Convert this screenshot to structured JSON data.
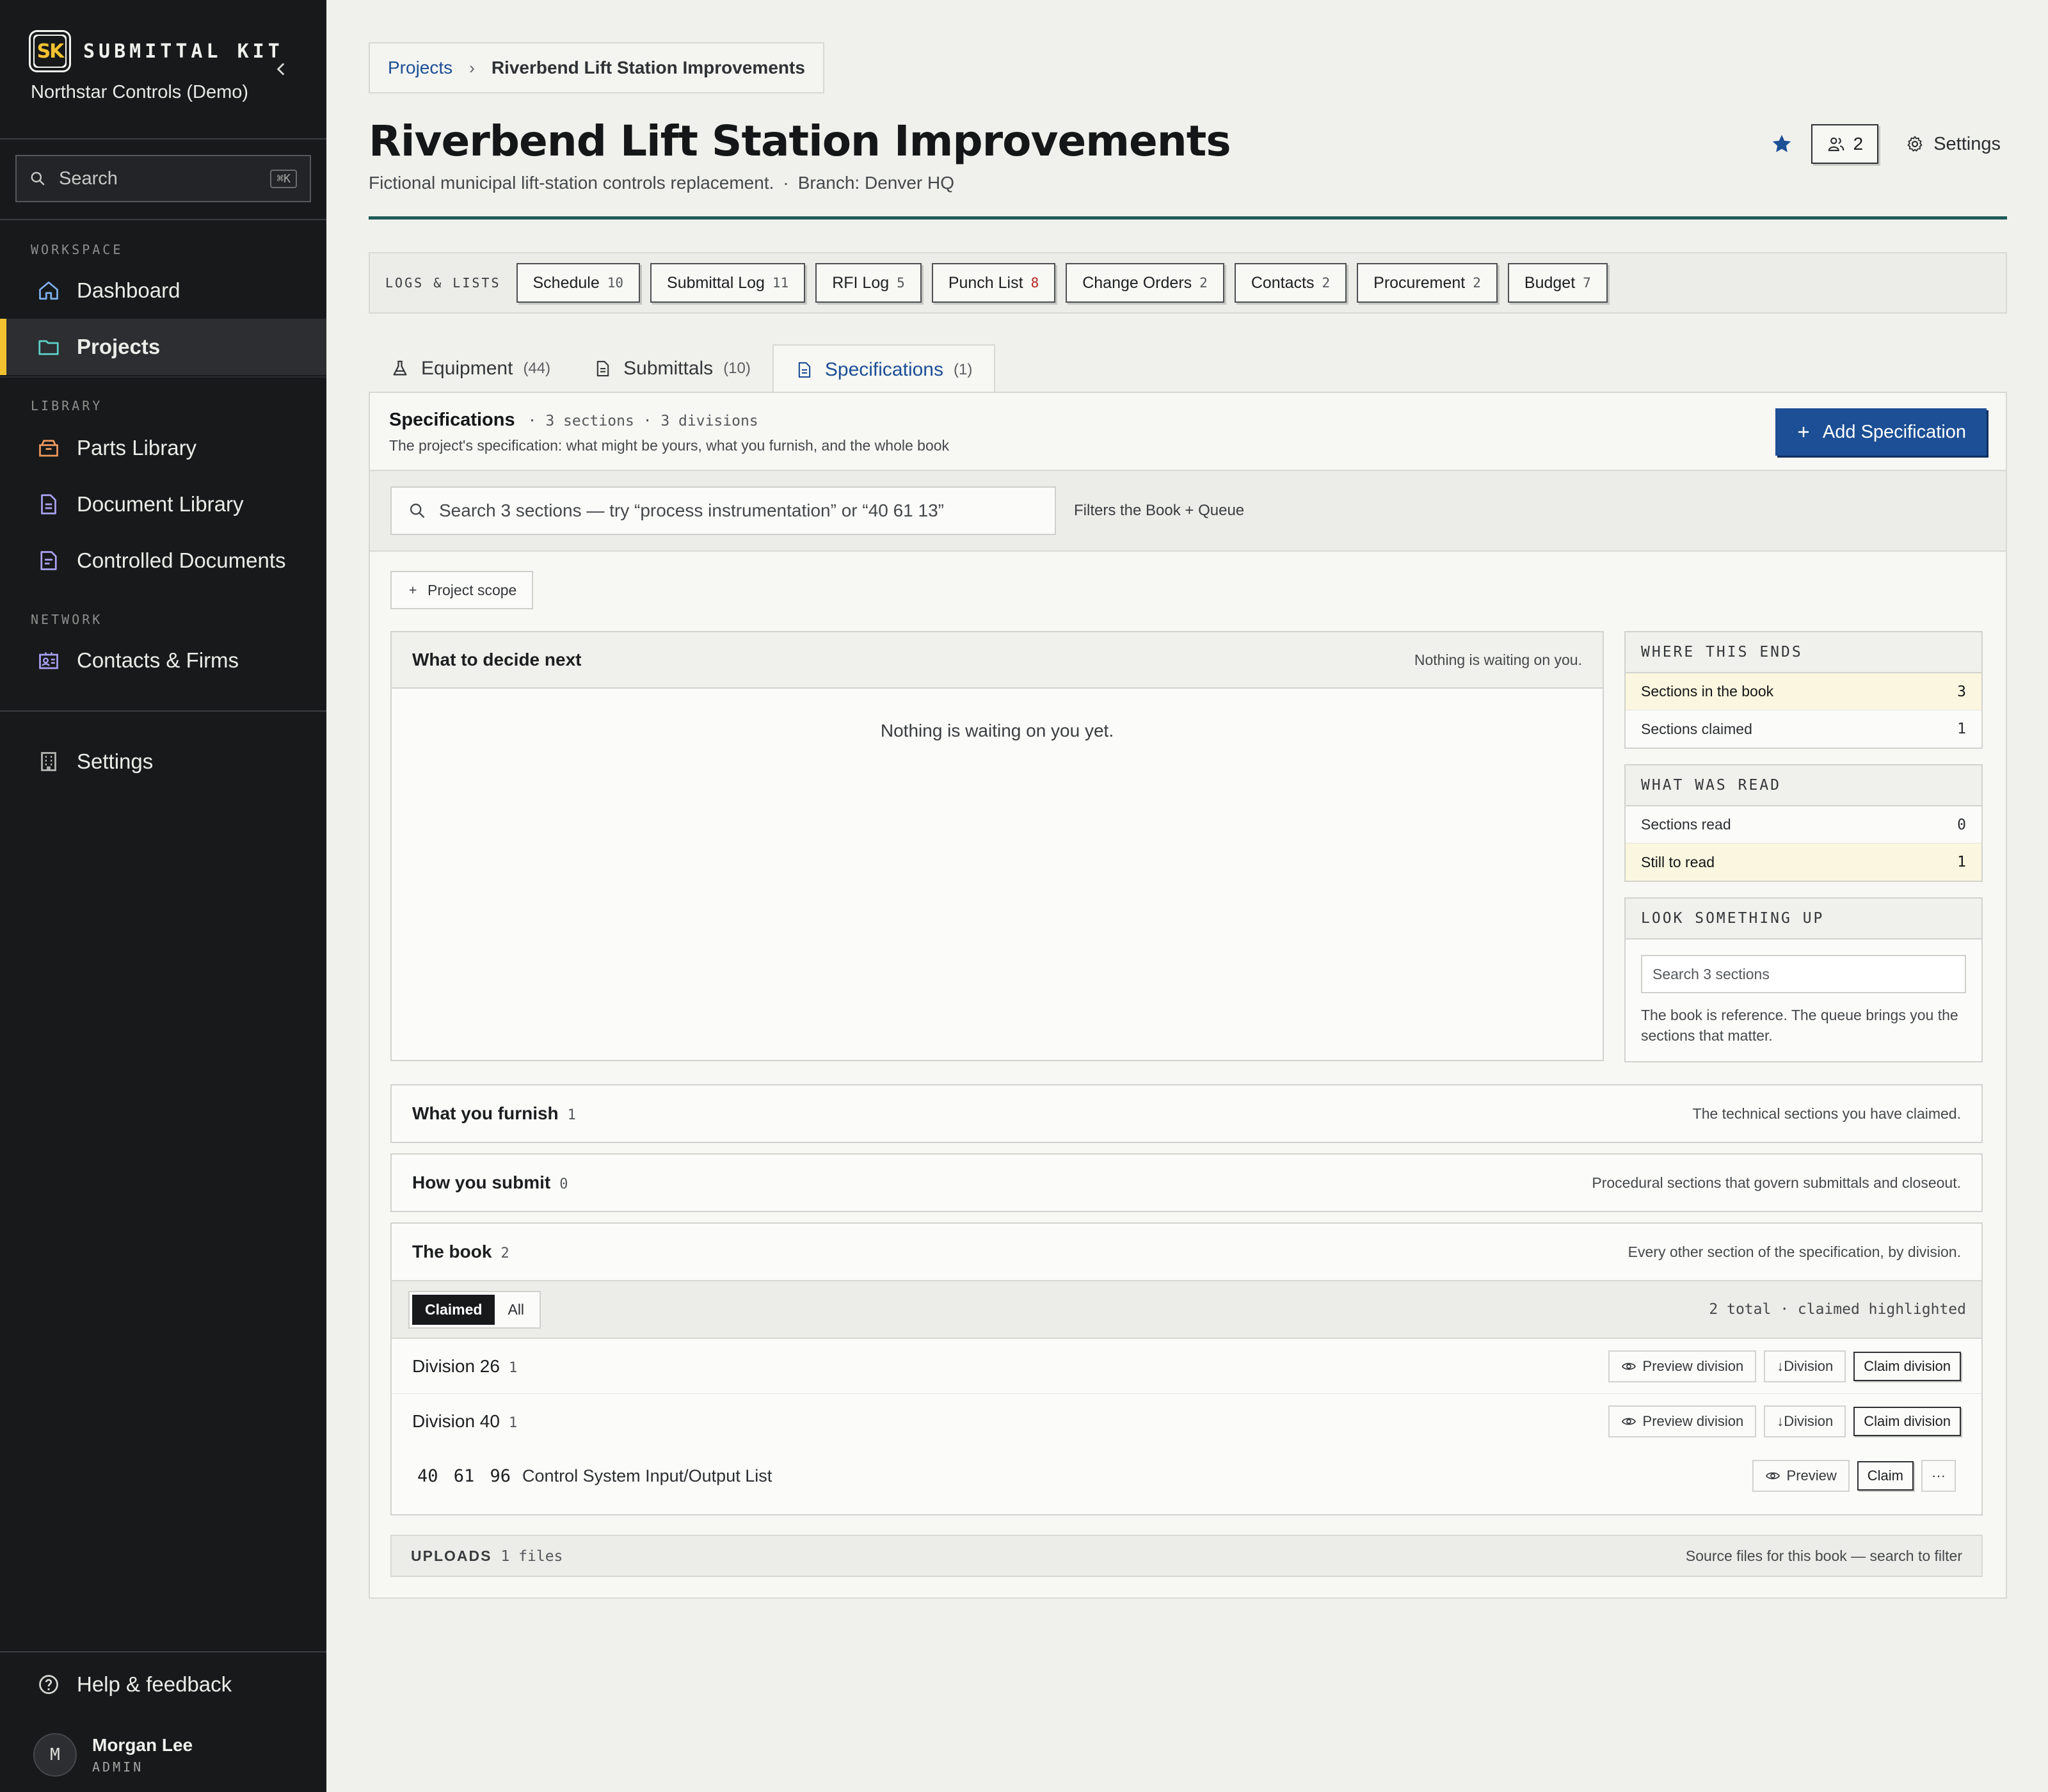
{
  "sidebar": {
    "brand": "SUBMITTAL KIT",
    "logo_text": "SK",
    "org": "Northstar Controls (Demo)",
    "search_label": "Search",
    "search_shortcut": "⌘K",
    "sections": {
      "workspace": "WORKSPACE",
      "library": "LIBRARY",
      "network": "NETWORK"
    },
    "items": [
      {
        "label": "Dashboard",
        "icon": "home-icon"
      },
      {
        "label": "Projects",
        "icon": "folder-icon",
        "active": true
      },
      {
        "label": "Parts Library",
        "icon": "box-icon"
      },
      {
        "label": "Document Library",
        "icon": "document-icon"
      },
      {
        "label": "Controlled Documents",
        "icon": "controlled-doc-icon"
      },
      {
        "label": "Contacts & Firms",
        "icon": "contacts-icon"
      },
      {
        "label": "Settings",
        "icon": "building-icon"
      }
    ],
    "help": "Help & feedback",
    "user": {
      "initial": "M",
      "name": "Morgan Lee",
      "role": "ADMIN"
    },
    "accent": "#f2c230"
  },
  "breadcrumb": {
    "parent": "Projects",
    "current": "Riverbend Lift Station Improvements"
  },
  "header": {
    "title": "Riverbend Lift Station Improvements",
    "description": "Fictional municipal lift-station controls replacement.",
    "branch": "Branch: Denver HQ",
    "members_count": "2",
    "settings_label": "Settings"
  },
  "logs": {
    "label": "LOGS & LISTS",
    "chips": [
      {
        "label": "Schedule",
        "count": "10"
      },
      {
        "label": "Submittal Log",
        "count": "11"
      },
      {
        "label": "RFI Log",
        "count": "5"
      },
      {
        "label": "Punch List",
        "count": "8"
      },
      {
        "label": "Change Orders",
        "count": "2"
      },
      {
        "label": "Contacts",
        "count": "2"
      },
      {
        "label": "Procurement",
        "count": "2"
      },
      {
        "label": "Budget",
        "count": "7"
      }
    ]
  },
  "tabs": [
    {
      "label": "Equipment",
      "count": "(44)"
    },
    {
      "label": "Submittals",
      "count": "(10)"
    },
    {
      "label": "Specifications",
      "count": "(1)",
      "active": true
    }
  ],
  "specs": {
    "title": "Specifications",
    "meta": "· 3 sections · 3 divisions",
    "description": "The project's specification: what might be yours, what you furnish, and the whole book",
    "add_label": "Add Specification",
    "search_placeholder": "Search 3 sections — try “process instrumentation” or “40 61 13”",
    "filter_note": "Filters the Book + Queue",
    "scope_label": "Project scope"
  },
  "decide": {
    "title": "What to decide next",
    "note": "Nothing is waiting on you.",
    "empty": "Nothing is waiting on you yet."
  },
  "where_ends": {
    "title": "WHERE THIS ENDS",
    "rows": [
      {
        "label": "Sections in the book",
        "value": "3"
      },
      {
        "label": "Sections claimed",
        "value": "1"
      }
    ]
  },
  "what_read": {
    "title": "WHAT WAS READ",
    "rows": [
      {
        "label": "Sections read",
        "value": "0"
      },
      {
        "label": "Still to read",
        "value": "1"
      }
    ]
  },
  "lookup": {
    "title": "LOOK SOMETHING UP",
    "placeholder": "Search 3 sections",
    "note": "The book is reference. The queue brings you the sections that matter."
  },
  "furnish": {
    "title": "What you furnish",
    "count": "1",
    "note": "The technical sections you have claimed."
  },
  "submit": {
    "title": "How you submit",
    "count": "0",
    "note": "Procedural sections that govern submittals and closeout."
  },
  "book": {
    "title": "The book",
    "count": "2",
    "note": "Every other section of the specification, by division.",
    "seg_claimed": "Claimed",
    "seg_all": "All",
    "total": "2 total · claimed highlighted",
    "preview_division": "Preview division",
    "download_division": "↓Division",
    "claim_division": "Claim division",
    "divisions": [
      {
        "name": "Division 26",
        "count": "1"
      },
      {
        "name": "Division 40",
        "count": "1"
      }
    ],
    "section": {
      "number": "40 61 96",
      "name": "Control System Input/Output List",
      "preview": "Preview",
      "claim": "Claim",
      "more": "···"
    }
  },
  "uploads": {
    "label": "UPLOADS",
    "count": "1 files",
    "note": "Source files for this book — search to filter"
  }
}
